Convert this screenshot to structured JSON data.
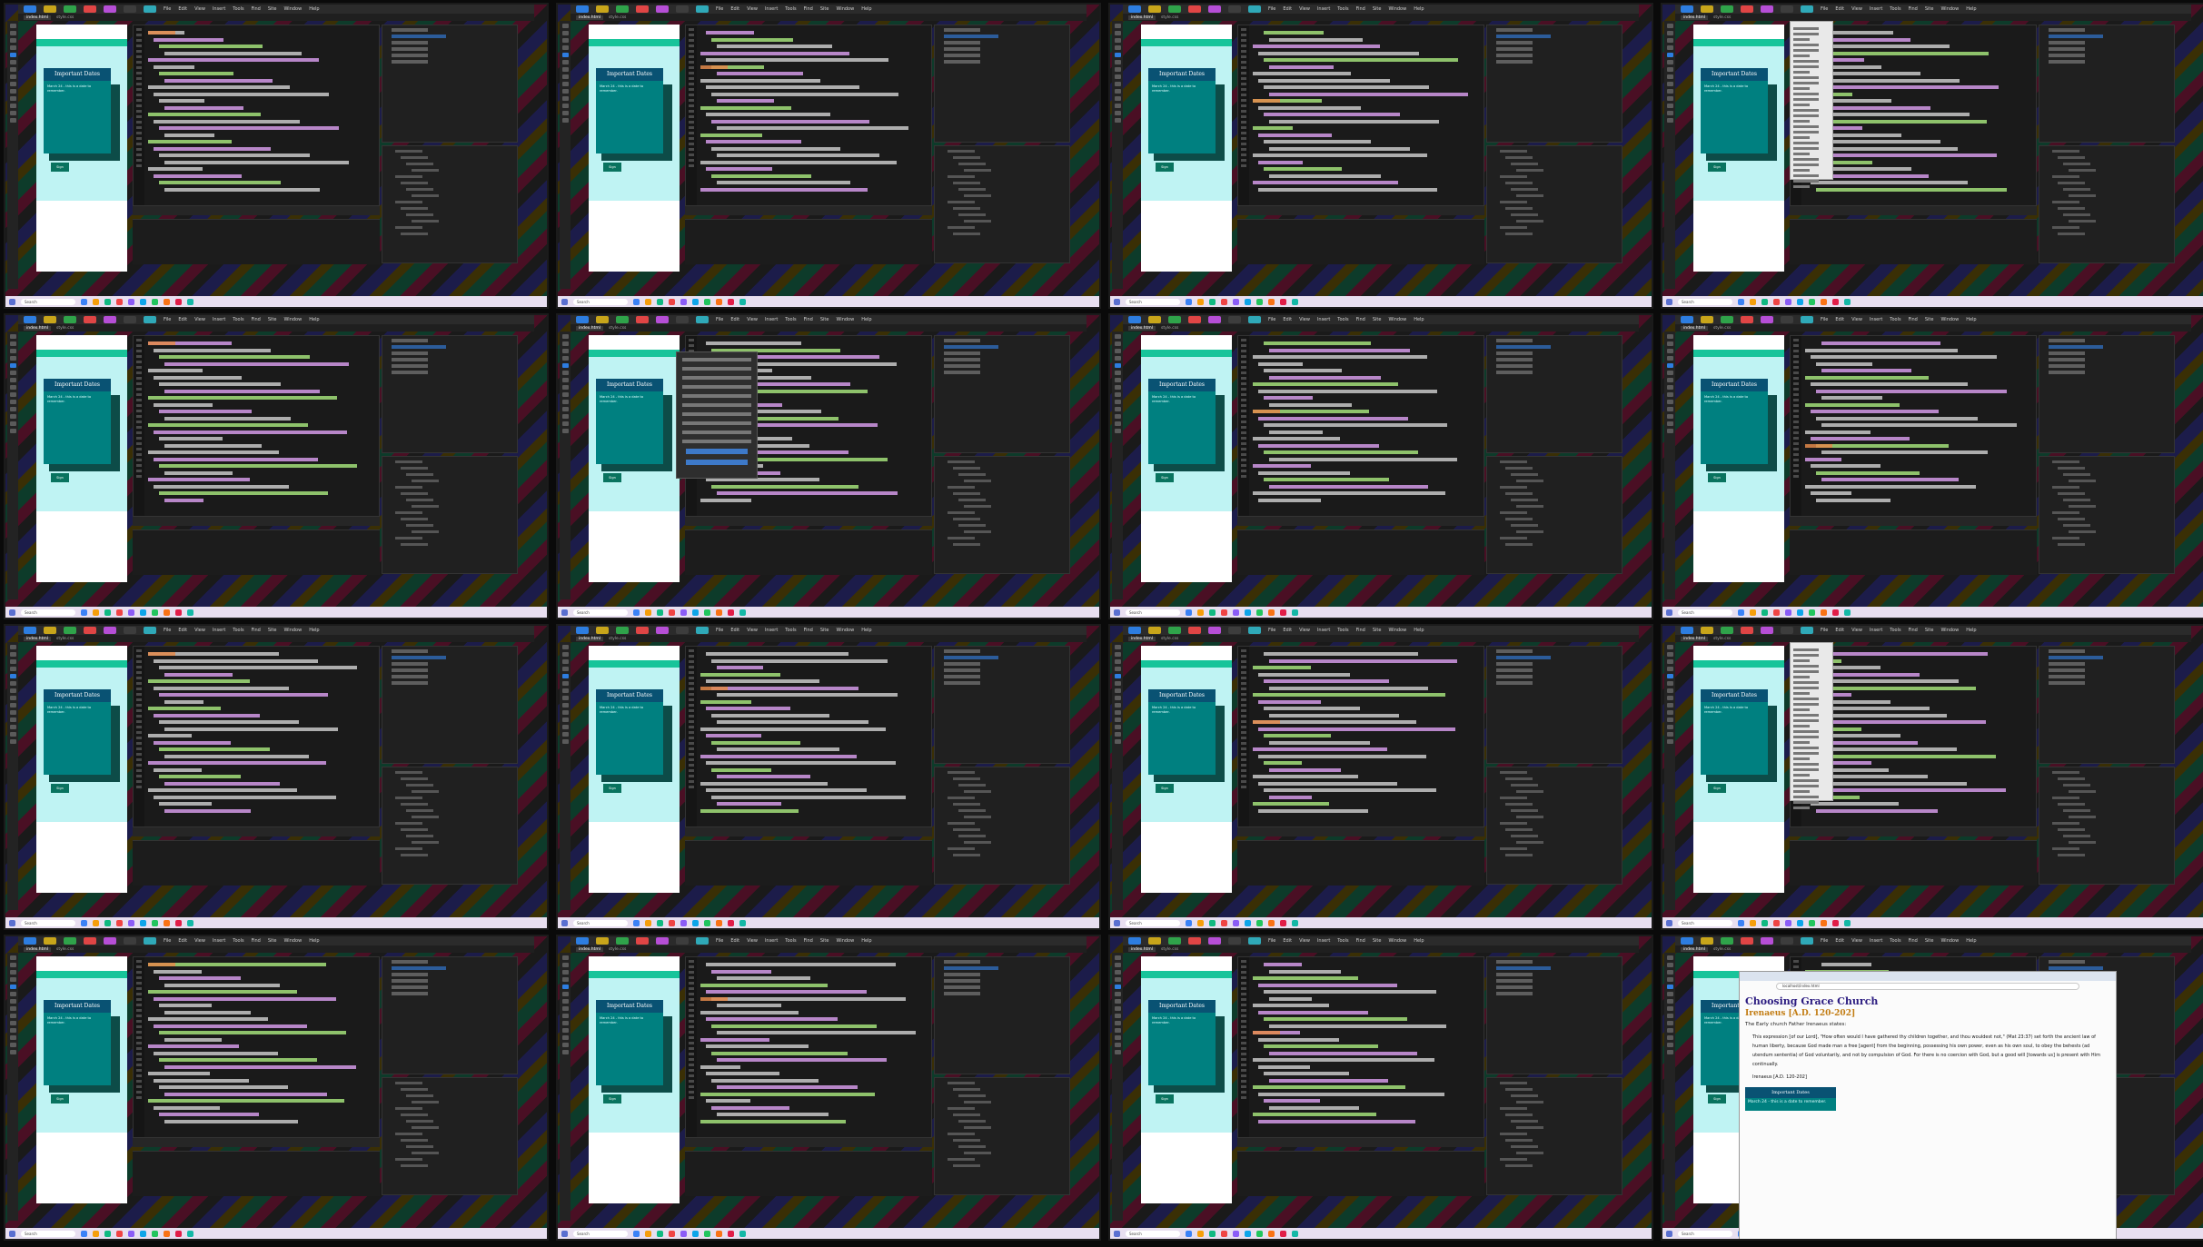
{
  "app": {
    "menus": [
      "File",
      "Edit",
      "View",
      "Insert",
      "Tools",
      "Find",
      "Site",
      "Window",
      "Help"
    ],
    "doc_tabs": [
      "index.html",
      "style.css"
    ],
    "taskbar_search": "Search"
  },
  "preview": {
    "heading": "Important Dates",
    "content": "March 24 - this is a date to remember.",
    "blue_serif": "Sign"
  },
  "browser": {
    "address": "localhost/index.html",
    "title": "Choosing Grace Church",
    "subtitle": "Irenaeus [A.D. 120-202]",
    "intro": "The Early church Father Irenaeus states:",
    "quote": "This expression [of our Lord], \"How often would I have gathered thy children together, and thou wouldest not,\" (Mat 23:37) set forth the ancient law of human liberty, because God made man a free [agent] from the beginning, possessing his own power, even as his own soul, to obey the behests (ad utendum sententia) of God voluntarily, and not by compulsion of God. For there is no coercion with God, but a good will [towards us] is present with Him continually.",
    "cite": "Irenaeus [A.D. 120-202]",
    "box_heading": "Important Dates",
    "box_content": "March 24 - this is a date to remember."
  },
  "frames": [
    {
      "variant": "editor",
      "hl_line": 23
    },
    {
      "variant": "editor",
      "hl_line": 25
    },
    {
      "variant": "editor",
      "hl_line": 24
    },
    {
      "variant": "menu",
      "hl_line": 24
    },
    {
      "variant": "editor",
      "hl_line": 26
    },
    {
      "variant": "dialog",
      "hl_line": 26
    },
    {
      "variant": "editor",
      "hl_line": 36
    },
    {
      "variant": "editor",
      "hl_line": 41
    },
    {
      "variant": "editor",
      "hl_line": 43
    },
    {
      "variant": "editor",
      "hl_line": 47
    },
    {
      "variant": "editor",
      "hl_line": 52
    },
    {
      "variant": "menu",
      "hl_line": 52
    },
    {
      "variant": "editor",
      "hl_line": 43
    },
    {
      "variant": "editor",
      "hl_line": 32
    },
    {
      "variant": "editor",
      "hl_line": 33
    },
    {
      "variant": "browser",
      "hl_line": 0
    }
  ],
  "colors": {
    "heading_bg": "#095273",
    "content_bg": "#008080",
    "shadow_bg": "#0d4c48",
    "blue_serif_bg": "#09735f"
  }
}
